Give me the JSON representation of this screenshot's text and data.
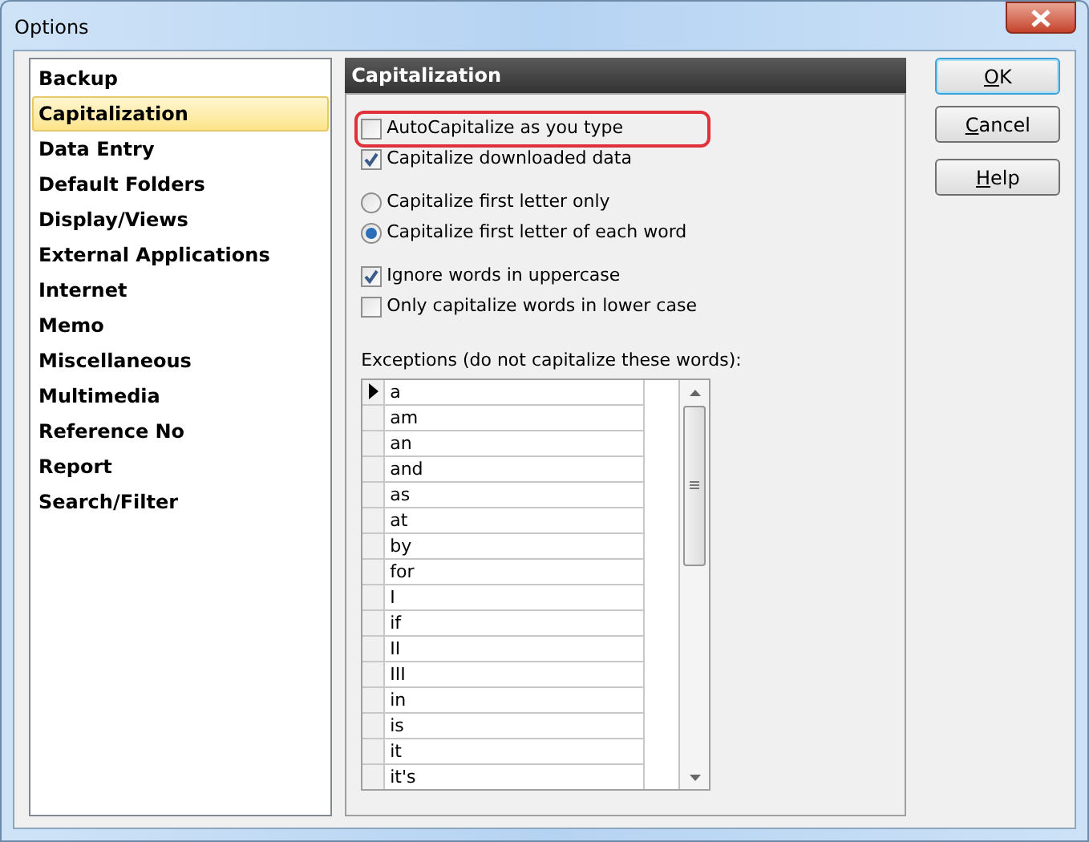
{
  "window": {
    "title": "Options"
  },
  "sidebar": {
    "items": [
      {
        "label": "Backup",
        "selected": false
      },
      {
        "label": "Capitalization",
        "selected": true
      },
      {
        "label": "Data Entry",
        "selected": false
      },
      {
        "label": "Default Folders",
        "selected": false
      },
      {
        "label": "Display/Views",
        "selected": false
      },
      {
        "label": "External Applications",
        "selected": false
      },
      {
        "label": "Internet",
        "selected": false
      },
      {
        "label": "Memo",
        "selected": false
      },
      {
        "label": "Miscellaneous",
        "selected": false
      },
      {
        "label": "Multimedia",
        "selected": false
      },
      {
        "label": "Reference No",
        "selected": false
      },
      {
        "label": "Report",
        "selected": false
      },
      {
        "label": "Search/Filter",
        "selected": false
      }
    ]
  },
  "panel": {
    "title": "Capitalization",
    "options": [
      {
        "kind": "checkbox",
        "label": "AutoCapitalize as you type",
        "checked": false,
        "highlighted": true
      },
      {
        "kind": "checkbox",
        "label": "Capitalize downloaded data",
        "checked": true,
        "highlighted": false
      },
      {
        "kind": "gap"
      },
      {
        "kind": "radio",
        "label": "Capitalize first letter only",
        "selected": false
      },
      {
        "kind": "radio",
        "label": "Capitalize first letter of each word",
        "selected": true
      },
      {
        "kind": "gap"
      },
      {
        "kind": "checkbox",
        "label": "Ignore words in uppercase",
        "checked": true,
        "highlighted": false
      },
      {
        "kind": "checkbox",
        "label": "Only capitalize words in lower case",
        "checked": false,
        "highlighted": false
      }
    ],
    "exceptions_label": "Exceptions (do not capitalize these words):",
    "exceptions": [
      {
        "word": "a",
        "current": true
      },
      {
        "word": "am",
        "current": false
      },
      {
        "word": "an",
        "current": false
      },
      {
        "word": "and",
        "current": false
      },
      {
        "word": "as",
        "current": false
      },
      {
        "word": "at",
        "current": false
      },
      {
        "word": "by",
        "current": false
      },
      {
        "word": "for",
        "current": false
      },
      {
        "word": "I",
        "current": false
      },
      {
        "word": "if",
        "current": false
      },
      {
        "word": "II",
        "current": false
      },
      {
        "word": "III",
        "current": false
      },
      {
        "word": "in",
        "current": false
      },
      {
        "word": "is",
        "current": false
      },
      {
        "word": "it",
        "current": false
      },
      {
        "word": "it's",
        "current": false
      }
    ]
  },
  "buttons": [
    {
      "label": "OK",
      "default": true
    },
    {
      "label": "Cancel",
      "default": false
    },
    {
      "label": "Help",
      "default": false
    }
  ]
}
